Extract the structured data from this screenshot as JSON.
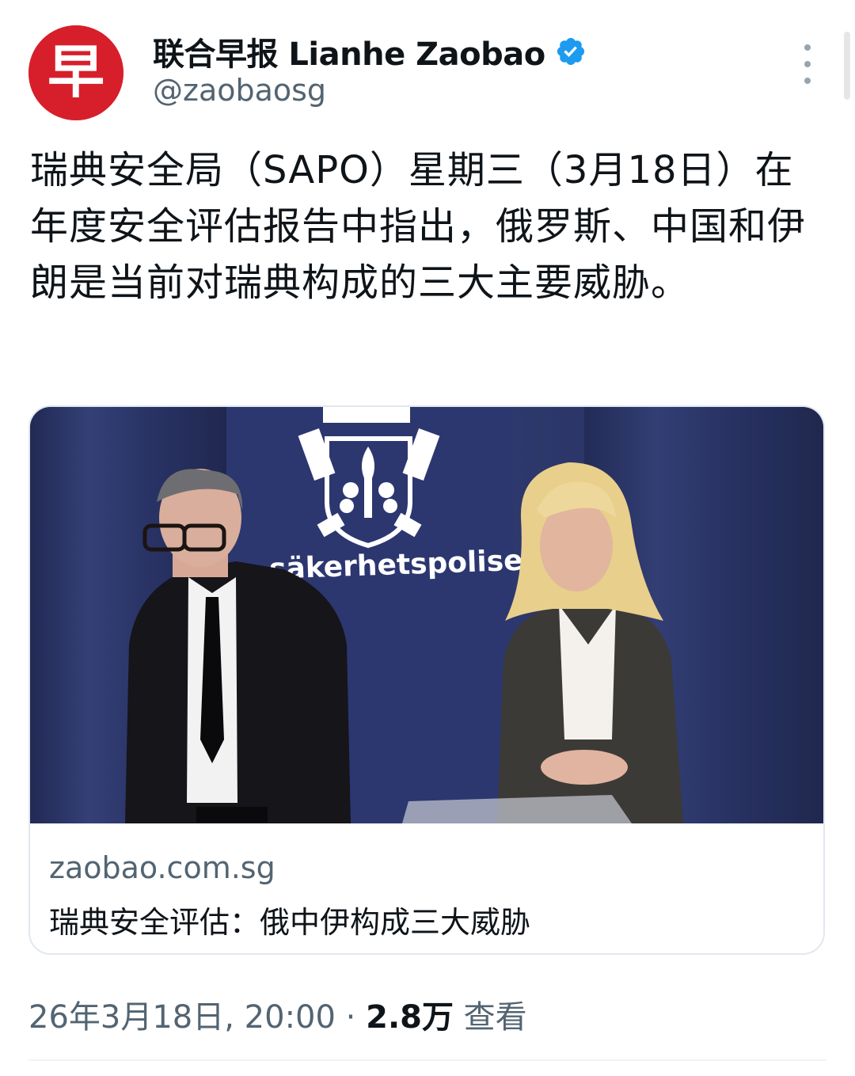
{
  "author": {
    "display_name": "联合早报 Lianhe Zaobao",
    "handle": "@zaobaosg",
    "avatar_glyph": "早",
    "avatar_color": "#d71f2b",
    "verified": true,
    "verified_color": "#1d9bf0"
  },
  "more_button_icon": "more-vertical-icon",
  "tweet": {
    "text": "瑞典安全局（SAPO）星期三（3月18日）在年度安全评估报告中指出，俄罗斯、中国和伊朗是当前对瑞典构成的三大主要威胁。"
  },
  "card": {
    "image_logo_text": "säkerhetspolisen",
    "domain": "zaobao.com.sg",
    "title": "瑞典安全评估：俄中伊构成三大威胁"
  },
  "meta": {
    "timestamp": "26年3月18日, 20:00",
    "separator": " · ",
    "views_count": "2.8万",
    "views_label": " 查看"
  }
}
